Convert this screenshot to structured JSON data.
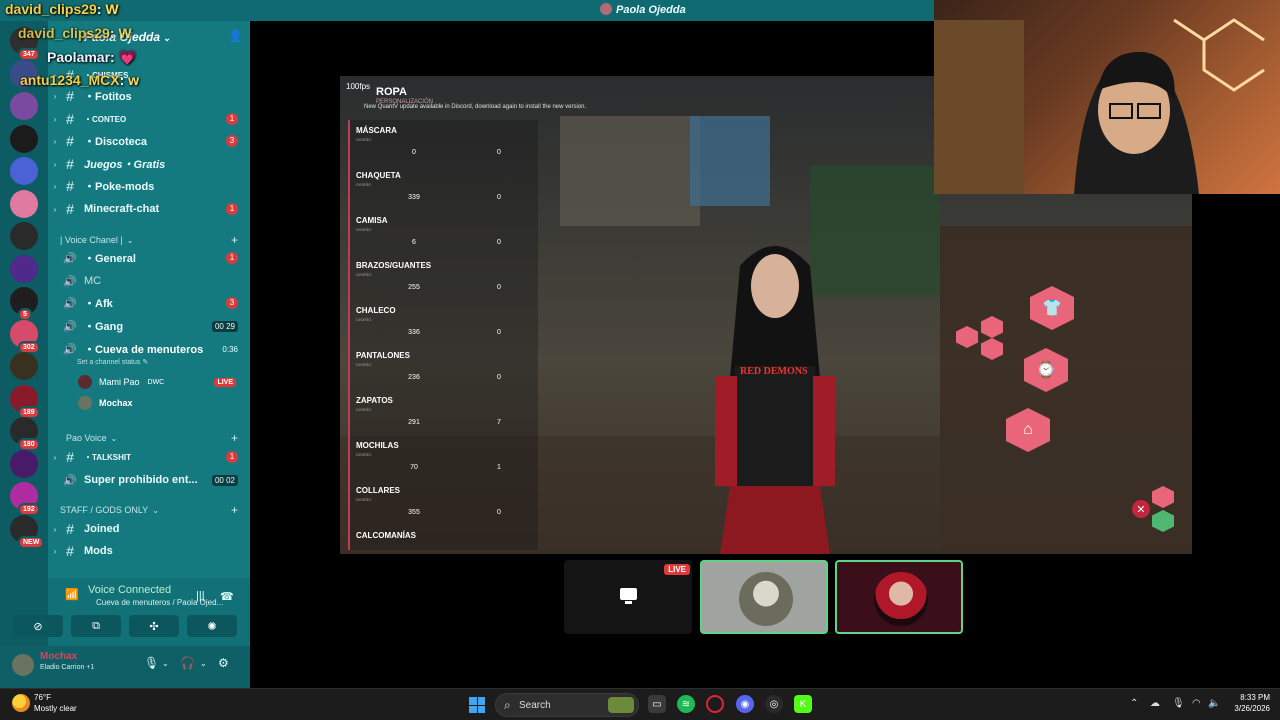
{
  "window": {
    "title": "Paola Ojedda"
  },
  "overlay_chat": [
    {
      "user": "david_clips29",
      "message": "W"
    },
    {
      "user": "david_clips29",
      "message": "W"
    },
    {
      "user": "Paolamar",
      "message": "💗"
    },
    {
      "user": "antu1234_MCX",
      "message": "w"
    }
  ],
  "servers": [
    {
      "badge": "347",
      "color": "#2f2f2f"
    },
    {
      "badge": "",
      "color": "#3a4b8a"
    },
    {
      "badge": "",
      "color": "#7a4aa0"
    },
    {
      "badge": "",
      "color": "#1b1b1b"
    },
    {
      "badge": "",
      "color": "#4b62d6"
    },
    {
      "badge": "",
      "color": "#e07aa0"
    },
    {
      "badge": "",
      "color": "#2a2a2a"
    },
    {
      "badge": "",
      "color": "#502a8a"
    },
    {
      "badge": "5",
      "color": "#1e1e1e"
    },
    {
      "badge": "302",
      "color": "#d84a6a"
    },
    {
      "badge": "",
      "color": "#3a3020"
    },
    {
      "badge": "189",
      "color": "#8a1a2a"
    },
    {
      "badge": "180",
      "color": "#2a2a2a"
    },
    {
      "badge": "",
      "color": "#4a1a6a"
    },
    {
      "badge": "192",
      "color": "#b02aa0"
    },
    {
      "badge": "NEW",
      "color": "#2a2a2a"
    }
  ],
  "channel_panel": {
    "server_name": "Paola Ojedda",
    "channels": [
      {
        "name": "・CHISMES",
        "count": ""
      },
      {
        "name": "・Fotitos",
        "count": ""
      },
      {
        "name": "・CONTEO",
        "count": "1"
      },
      {
        "name": "・Discoteca",
        "count": "3"
      },
      {
        "name": "Juegos・Gratis",
        "count": ""
      },
      {
        "name": "・Poke-mods",
        "count": ""
      },
      {
        "name": "Minecraft-chat",
        "count": "1"
      }
    ],
    "voice_category": "| Voice Chanel |",
    "voice_channels": [
      {
        "name": "・General",
        "count": "1",
        "extra": ""
      },
      {
        "name": "MC",
        "count": "",
        "extra": ""
      },
      {
        "name": "・Afk",
        "count": "3",
        "extra": ""
      },
      {
        "name": "・Gang",
        "count": "",
        "extra": "00 29"
      },
      {
        "name": "・Cueva de menuteros",
        "count": "",
        "extra": "0:36"
      }
    ],
    "status_hint": "Set a channel status",
    "voice_users": [
      {
        "name": "Mami Pao",
        "tag": "DWC",
        "live": "LIVE"
      },
      {
        "name": "Mochax",
        "tag": "",
        "live": ""
      }
    ],
    "pao_category": "Pao Voice",
    "pao_channels": [
      {
        "name": "・TALKSHIT",
        "count": "1",
        "extra": ""
      },
      {
        "name": "Super prohibido ent...",
        "count": "",
        "extra": "00 02"
      }
    ],
    "staff_category": "STAFF / GODS ONLY",
    "staff_channels": [
      {
        "name": "Joined"
      },
      {
        "name": "Mods"
      }
    ]
  },
  "voice_panel": {
    "title": "Voice Connected",
    "subtitle": "Cueva de menuteros / Paola Ojed..."
  },
  "user_panel": {
    "name": "Mochax",
    "status": "Eladio Carrion +1"
  },
  "game": {
    "fps": "100fps",
    "update_note": "New QuantV update available in Discord, download again to install the new version.",
    "menu_title": "ROPA",
    "menu_subtitle": "PERSONALIZACIÓN",
    "sections": [
      {
        "name": "MÁSCARA",
        "design": "0",
        "texture": "0"
      },
      {
        "name": "CHAQUETA",
        "design": "339",
        "texture": "0"
      },
      {
        "name": "CAMISA",
        "design": "6",
        "texture": "0"
      },
      {
        "name": "BRAZOS/GUANTES",
        "design": "255",
        "texture": "0"
      },
      {
        "name": "CHALECO",
        "design": "336",
        "texture": "0"
      },
      {
        "name": "PANTALONES",
        "design": "236",
        "texture": "0"
      },
      {
        "name": "ZAPATOS",
        "design": "291",
        "texture": "7"
      },
      {
        "name": "MOCHILAS",
        "design": "70",
        "texture": "1"
      },
      {
        "name": "COLLARES",
        "design": "355",
        "texture": "0"
      },
      {
        "name": "CALCOMANÍAS",
        "design": "",
        "texture": ""
      }
    ],
    "shirt_text": "RED DEMONS"
  },
  "stream_tiles": {
    "live_badge": "LIVE"
  },
  "taskbar": {
    "temperature": "76°F",
    "weather": "Mostly clear",
    "search_placeholder": "Search",
    "time": "8:33 PM",
    "date": "3/26/2026"
  }
}
